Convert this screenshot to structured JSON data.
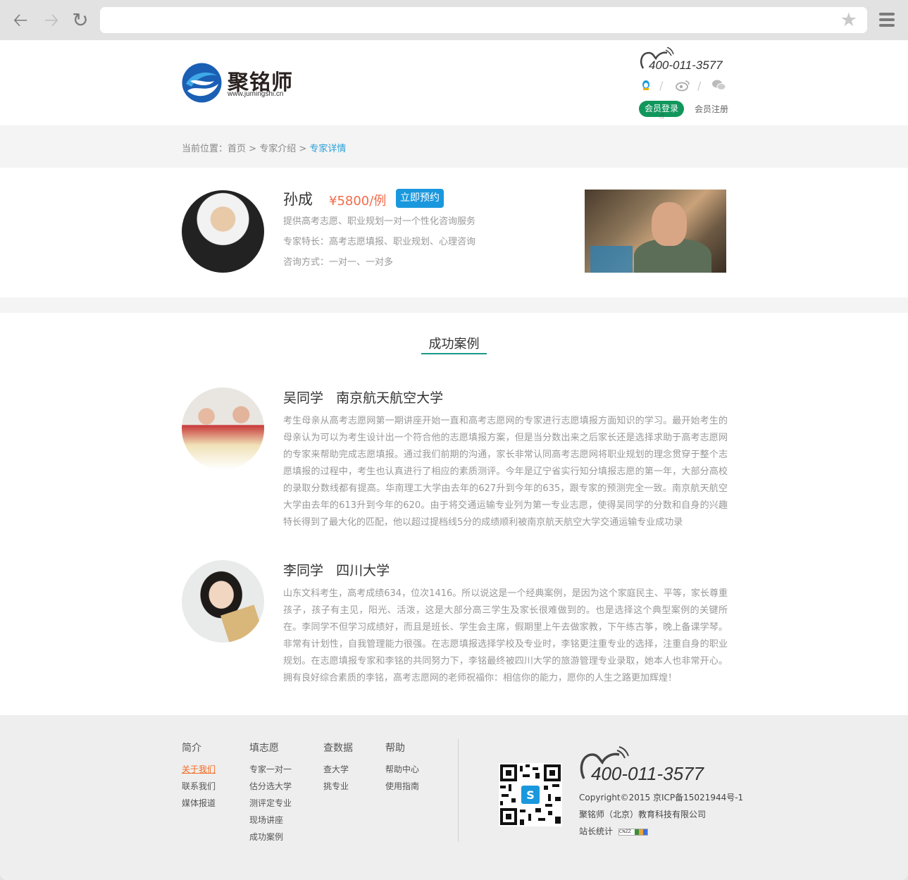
{
  "brand": {
    "name": "聚铭师",
    "url": "www.jumingshi.cn"
  },
  "header": {
    "hotline": "400-011-3577",
    "login_label": "会员登录",
    "register_label": "会员注册",
    "social_icons": [
      "qq-icon",
      "weibo-icon",
      "wechat-icon"
    ]
  },
  "breadcrumb": {
    "prefix": "当前位置：",
    "home": "首页",
    "sep1": " > ",
    "parent": "专家介绍",
    "sep2": " > ",
    "current": "专家详情"
  },
  "expert": {
    "name": "孙成",
    "price": "¥5800/例",
    "book_label": "立即预约",
    "service": "提供高考志愿、职业规划一对一个性化咨询服务",
    "specialty": "专家特长：高考志愿填报、职业规划、心理咨询",
    "consult": "咨询方式：一对一、一对多"
  },
  "cases_section": {
    "title": "成功案例",
    "items": [
      {
        "title": "吴同学   南京航天航空大学",
        "text": "考生母亲从高考志愿网第一期讲座开始一直和高考志愿网的专家进行志愿填报方面知识的学习。最开始考生的母亲认为可以为考生设计出一个符合他的志愿填报方案，但是当分数出来之后家长还是选择求助于高考志愿网的专家来帮助完成志愿填报。通过我们前期的沟通，家长非常认同高考志愿网将职业规划的理念贯穿于整个志愿填报的过程中，考生也认真进行了相应的素质测评。今年是辽宁省实行知分填报志愿的第一年，大部分高校的录取分数线都有提高。华南理工大学由去年的627升到今年的635，跟专家的预测完全一致。南京航天航空大学由去年的613升到今年的620。由于将交通运输专业列为第一专业志愿，使得吴同学的分数和自身的兴趣特长得到了最大化的匹配，他以超过提档线5分的成绩顺利被南京航天航空大学交通运输专业成功录"
      },
      {
        "title": "李同学   四川大学",
        "text": "山东文科考生，高考成绩634，位次1416。所以说这是一个经典案例，是因为这个家庭民主、平等，家长尊重孩子，孩子有主见，阳光、活泼，这是大部分高三学生及家长很难做到的。也是选择这个典型案例的关键所在。李同学不但学习成绩好，而且是班长、学生会主席，假期里上午去做家教，下午练古筝，晚上备课学琴。非常有计划性，自我管理能力很强。在志愿填报选择学校及专业时，李铭更注重专业的选择，注重自身的职业规划。在志愿填报专家和李铭的共同努力下，李铭最终被四川大学的旅游管理专业录取，她本人也非常开心。拥有良好综合素质的李铭，高考志愿网的老师祝福你：相信你的能力，愿你的人生之路更加辉煌！"
      }
    ]
  },
  "footer": {
    "columns": [
      {
        "head": "简介",
        "links": [
          "关于我们",
          "联系我们",
          "媒体报道"
        ]
      },
      {
        "head": "填志愿",
        "links": [
          "专家一对一",
          "估分选大学",
          "测评定专业",
          "现场讲座",
          "成功案例"
        ]
      },
      {
        "head": "查数据",
        "links": [
          "查大学",
          "挑专业"
        ]
      },
      {
        "head": "帮助",
        "links": [
          "帮助中心",
          "使用指南"
        ]
      }
    ],
    "hotline": "400-011-3577",
    "copyright": "Copyright©2015 京ICP备15021944号-1",
    "company": "聚铭师（北京）教育科技有限公司",
    "stats_label": "站长统计",
    "stats_badge": "CNZZ"
  },
  "colors": {
    "accent_green": "#11965c",
    "accent_blue": "#1a98de",
    "price_orange": "#f36b4a",
    "link_blue": "#2a9fd8",
    "section_teal": "#1a9a8a"
  }
}
